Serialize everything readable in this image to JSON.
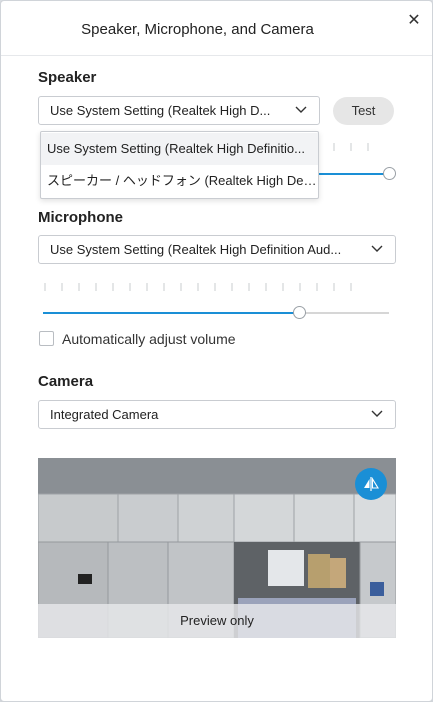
{
  "dialog": {
    "title": "Speaker, Microphone, and Camera",
    "close_icon": "close-icon"
  },
  "speaker": {
    "label": "Speaker",
    "selected": "Use System Setting (Realtek High D...",
    "test_label": "Test",
    "dropdown_options": [
      "Use System Setting (Realtek High Definitio...",
      "スピーカー / ヘッドフォン (Realtek High Definiti..."
    ],
    "volume_fraction": 1.0
  },
  "microphone": {
    "label": "Microphone",
    "selected": "Use System Setting (Realtek High Definition Aud...",
    "volume_fraction": 0.74,
    "auto_adjust_label": "Automatically adjust volume",
    "auto_adjust_checked": false
  },
  "camera": {
    "label": "Camera",
    "selected": "Integrated Camera",
    "preview_label": "Preview only",
    "flip_icon": "mirror-flip-icon"
  },
  "colors": {
    "accent": "#1a8fd6"
  }
}
